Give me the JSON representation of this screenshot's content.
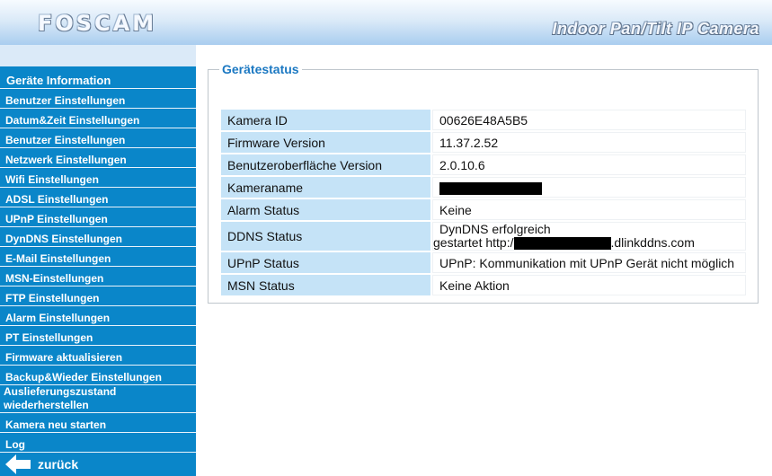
{
  "header": {
    "logo": "FOSCAM",
    "subtitle": "Indoor Pan/Tilt IP Camera"
  },
  "sidebar": {
    "items": [
      {
        "label": "Geräte Information"
      },
      {
        "label": "Benutzer Einstellungen"
      },
      {
        "label": "Datum&Zeit Einstellungen"
      },
      {
        "label": "Benutzer Einstellungen"
      },
      {
        "label": "Netzwerk Einstellungen"
      },
      {
        "label": "Wifi Einstellungen"
      },
      {
        "label": "ADSL Einstellungen"
      },
      {
        "label": "UPnP Einstellungen"
      },
      {
        "label": "DynDNS Einstellungen"
      },
      {
        "label": "E-Mail Einstellungen"
      },
      {
        "label": "MSN-Einstellungen"
      },
      {
        "label": "FTP Einstellungen"
      },
      {
        "label": "Alarm Einstellungen"
      },
      {
        "label": "PT Einstellungen"
      },
      {
        "label": "Firmware aktualisieren"
      },
      {
        "label": "Backup&Wieder Einstellungen"
      },
      {
        "label_line1": "Auslieferungszustand",
        "label_line2": "wiederherstellen"
      },
      {
        "label": "Kamera neu starten"
      },
      {
        "label": "Log"
      }
    ],
    "back_label": "zurück"
  },
  "main": {
    "section_title": "Gerätestatus",
    "rows": [
      {
        "key": "Kamera ID",
        "value": "00626E48A5B5"
      },
      {
        "key": "Firmware Version",
        "value": "11.37.2.52"
      },
      {
        "key": "Benutzeroberfläche Version",
        "value": "2.0.10.6"
      },
      {
        "key": "Kameraname",
        "value": ""
      },
      {
        "key": "Alarm Status",
        "value": "Keine"
      },
      {
        "key": "DDNS Status",
        "value_line1": "DynDNS erfolgreich",
        "value_line2_prefix": "gestartet  http:/",
        "value_line2_suffix": ".dlinkddns.com"
      },
      {
        "key": "UPnP Status",
        "value": "UPnP: Kommunikation mit UPnP Gerät nicht möglich"
      },
      {
        "key": "MSN Status",
        "value": "Keine Aktion"
      }
    ]
  },
  "colors": {
    "menu_bg": "#0a86c9",
    "key_cell_bg": "#c5e3f7",
    "legend_text": "#1b78c2"
  }
}
